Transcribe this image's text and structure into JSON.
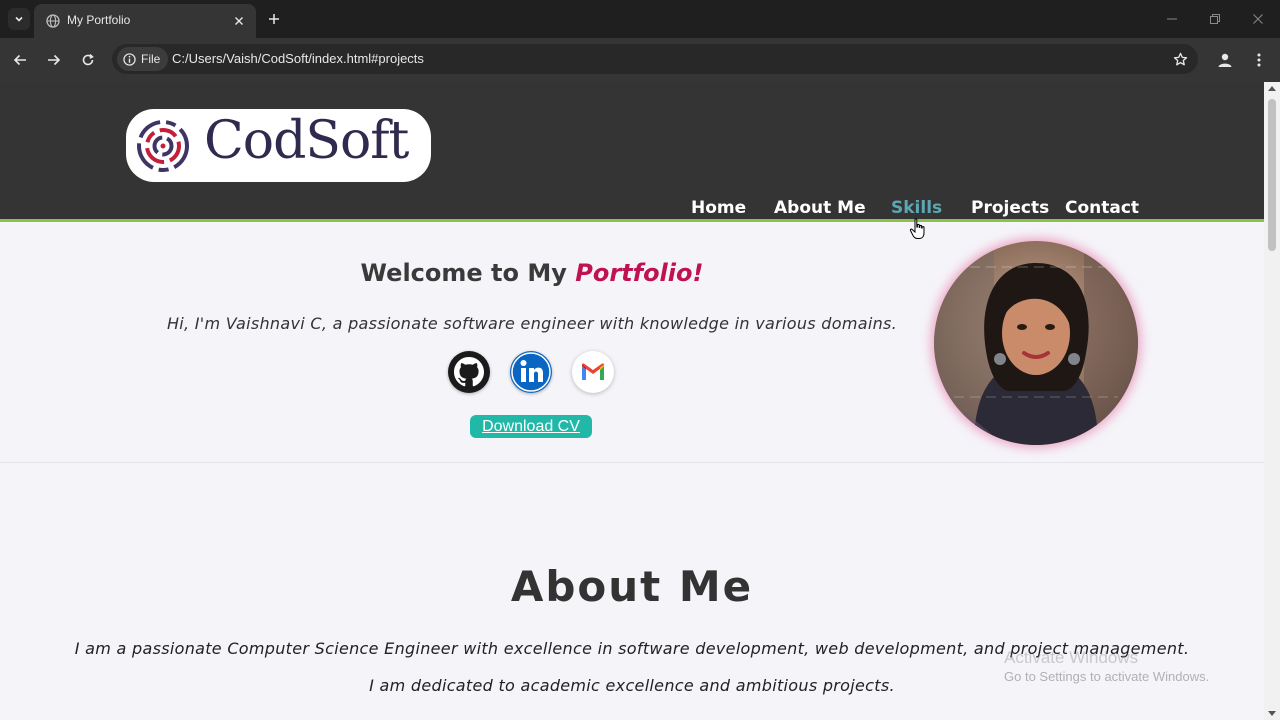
{
  "browser": {
    "tab_title": "My Portfolio",
    "address_chip": "File",
    "url": "C:/Users/Vaish/CodSoft/index.html#projects"
  },
  "site": {
    "logo_text": "CodSoft",
    "nav": [
      {
        "label": "Home"
      },
      {
        "label": "About Me"
      },
      {
        "label": "Skills"
      },
      {
        "label": "Projects"
      },
      {
        "label": "Contact"
      }
    ],
    "active_nav": "Skills",
    "hero": {
      "welcome_prefix": "Welcome to My",
      "welcome_accent": "Portfolio!",
      "intro": "Hi, I'm Vaishnavi C, a passionate software engineer with knowledge in various domains.",
      "download_cv": "Download CV"
    },
    "about": {
      "title": "About Me",
      "line1": "I am a passionate Computer Science Engineer with excellence in software development, web development, and project management.",
      "line2": "I am dedicated to academic excellence and ambitious projects."
    }
  },
  "watermark": {
    "line1": "Activate Windows",
    "line2": "Go to Settings to activate Windows."
  },
  "colors": {
    "header_bg": "#343434",
    "header_border": "#8bc34a",
    "accent": "#c0124f",
    "nav_active": "#5ba7b3",
    "cv_button": "#22b8a8"
  }
}
